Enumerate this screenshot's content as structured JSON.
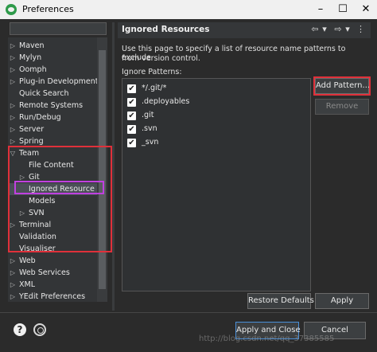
{
  "window": {
    "title": "Preferences",
    "minimize": "–",
    "maximize": "☐",
    "close": "✕"
  },
  "tree": {
    "items": [
      {
        "label": "Maven",
        "arrow": "▷",
        "indent": 0
      },
      {
        "label": "Mylyn",
        "arrow": "▷",
        "indent": 0
      },
      {
        "label": "Oomph",
        "arrow": "▷",
        "indent": 0
      },
      {
        "label": "Plug-in Development",
        "arrow": "▷",
        "indent": 0
      },
      {
        "label": "Quick Search",
        "arrow": "",
        "indent": 0
      },
      {
        "label": "Remote Systems",
        "arrow": "▷",
        "indent": 0
      },
      {
        "label": "Run/Debug",
        "arrow": "▷",
        "indent": 0
      },
      {
        "label": "Server",
        "arrow": "▷",
        "indent": 0
      },
      {
        "label": "Spring",
        "arrow": "▷",
        "indent": 0
      },
      {
        "label": "Team",
        "arrow": "▽",
        "indent": 0
      },
      {
        "label": "File Content",
        "arrow": "",
        "indent": 1
      },
      {
        "label": "Git",
        "arrow": "▷",
        "indent": 1
      },
      {
        "label": "Ignored Resource",
        "arrow": "",
        "indent": 1,
        "selected": true
      },
      {
        "label": "Models",
        "arrow": "",
        "indent": 1
      },
      {
        "label": "SVN",
        "arrow": "▷",
        "indent": 1
      },
      {
        "label": "Terminal",
        "arrow": "▷",
        "indent": 0
      },
      {
        "label": "Validation",
        "arrow": "",
        "indent": 0
      },
      {
        "label": "Visualiser",
        "arrow": "",
        "indent": 0
      },
      {
        "label": "Web",
        "arrow": "▷",
        "indent": 0
      },
      {
        "label": "Web Services",
        "arrow": "▷",
        "indent": 0
      },
      {
        "label": "XML",
        "arrow": "▷",
        "indent": 0
      },
      {
        "label": "YEdit Preferences",
        "arrow": "▷",
        "indent": 0
      }
    ]
  },
  "page": {
    "title": "Ignored Resources",
    "nav": {
      "back": "⇦",
      "back_menu": "▾",
      "forward": "⇨",
      "forward_menu": "▾",
      "menu": "⋮"
    },
    "description_line1": "Use this page to specify a list of resource name patterns to exclude",
    "description_line2": "from version control.",
    "patterns_label": "Ignore Patterns:",
    "patterns": [
      {
        "text": "*/.git/*",
        "checked": true
      },
      {
        "text": ".deployables",
        "checked": true
      },
      {
        "text": ".git",
        "checked": true
      },
      {
        "text": ".svn",
        "checked": true
      },
      {
        "text": "_svn",
        "checked": true
      }
    ],
    "check_mark": "✔",
    "add_pattern": "Add Pattern...",
    "remove": "Remove",
    "restore_defaults": "Restore Defaults",
    "apply": "Apply"
  },
  "footer": {
    "help": "?",
    "apply_and_close": "Apply and Close",
    "cancel": "Cancel",
    "watermark": "http://blog.csdn.net/qq_37385585"
  },
  "colors": {
    "highlight_red": "#e0303a",
    "highlight_purple": "#c040e0",
    "background": "#2b2b2b"
  }
}
